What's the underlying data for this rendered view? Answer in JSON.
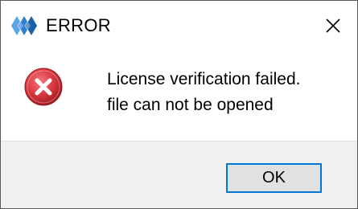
{
  "dialog": {
    "title": "ERROR",
    "app_icon": "diamond-logo-icon",
    "close_icon": "close-icon",
    "message_icon": "error-icon",
    "message_lines": [
      "License verification failed.",
      "file can not be opened"
    ],
    "ok_label": "OK"
  },
  "colors": {
    "accent": "#0078d7",
    "error_red": "#d9363e",
    "button_area_bg": "#f0f0f0",
    "logo_blue": "#2f80d0"
  }
}
